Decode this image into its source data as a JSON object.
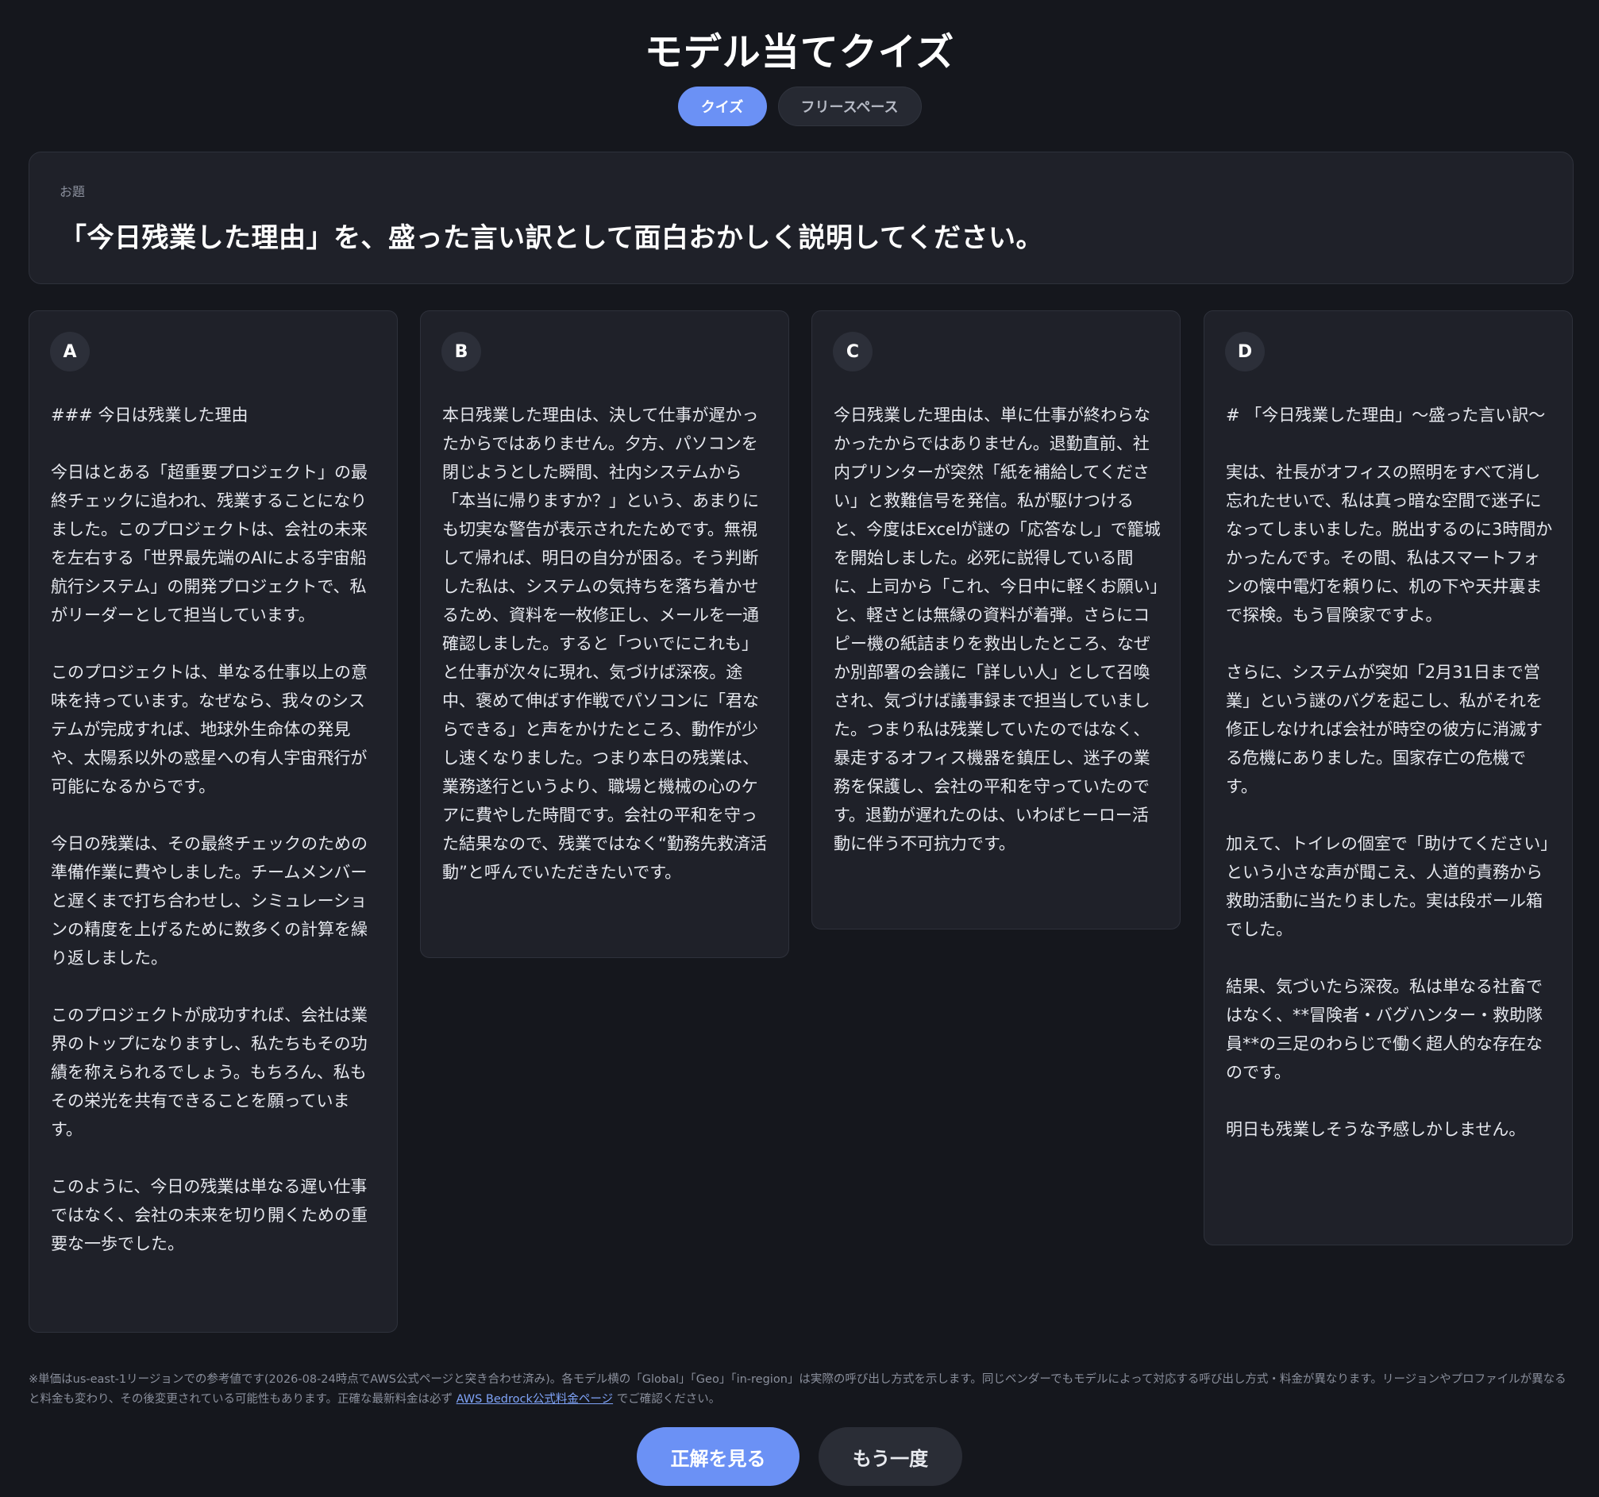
{
  "header": {
    "title": "モデル当てクイズ"
  },
  "tabs": [
    {
      "label": "クイズ",
      "active": true
    },
    {
      "label": "フリースペース",
      "active": false
    }
  ],
  "prompt": {
    "label": "お題",
    "text": "「今日残業した理由」を、盛った言い訳として面白おかしく説明してください。"
  },
  "answers": [
    {
      "letter": "A",
      "paragraphs": [
        "### 今日は残業した理由",
        "今日はとある「超重要プロジェクト」の最終チェックに追われ、残業することになりました。このプロジェクトは、会社の未来を左右する「世界最先端のAIによる宇宙船航行システム」の開発プロジェクトで、私がリーダーとして担当しています。",
        "このプロジェクトは、単なる仕事以上の意味を持っています。なぜなら、我々のシステムが完成すれば、地球外生命体の発見や、太陽系以外の惑星への有人宇宙飛行が可能になるからです。",
        "今日の残業は、その最終チェックのための準備作業に費やしました。チームメンバーと遅くまで打ち合わせし、シミュレーションの精度を上げるために数多くの計算を繰り返しました。",
        "このプロジェクトが成功すれば、会社は業界のトップになりますし、私たちもその功績を称えられるでしょう。もちろん、私もその栄光を共有できることを願っています。",
        "このように、今日の残業は単なる遅い仕事ではなく、会社の未来を切り開くための重要な一歩でした。"
      ]
    },
    {
      "letter": "B",
      "paragraphs": [
        "本日残業した理由は、決して仕事が遅かったからではありません。夕方、パソコンを閉じようとした瞬間、社内システムから「本当に帰りますか？」という、あまりにも切実な警告が表示されたためです。無視して帰れば、明日の自分が困る。そう判断した私は、システムの気持ちを落ち着かせるため、資料を一枚修正し、メールを一通確認しました。すると「ついでにこれも」と仕事が次々に現れ、気づけば深夜。途中、褒めて伸ばす作戦でパソコンに「君ならできる」と声をかけたところ、動作が少し速くなりました。つまり本日の残業は、業務遂行というより、職場と機械の心のケアに費やした時間です。会社の平和を守った結果なので、残業ではなく“勤務先救済活動”と呼んでいただきたいです。"
      ]
    },
    {
      "letter": "C",
      "paragraphs": [
        "今日残業した理由は、単に仕事が終わらなかったからではありません。退勤直前、社内プリンターが突然「紙を補給してください」と救難信号を発信。私が駆けつけると、今度はExcelが謎の「応答なし」で籠城を開始しました。必死に説得している間に、上司から「これ、今日中に軽くお願い」と、軽さとは無縁の資料が着弾。さらにコピー機の紙詰まりを救出したところ、なぜか別部署の会議に「詳しい人」として召喚され、気づけば議事録まで担当していました。つまり私は残業していたのではなく、暴走するオフィス機器を鎮圧し、迷子の業務を保護し、会社の平和を守っていたのです。退勤が遅れたのは、いわばヒーロー活動に伴う不可抗力です。"
      ]
    },
    {
      "letter": "D",
      "paragraphs": [
        "# 「今日残業した理由」〜盛った言い訳〜",
        "実は、社長がオフィスの照明をすべて消し忘れたせいで、私は真っ暗な空間で迷子になってしまいました。脱出するのに3時間かかったんです。その間、私はスマートフォンの懐中電灯を頼りに、机の下や天井裏まで探検。もう冒険家ですよ。",
        "さらに、システムが突如「2月31日まで営業」という謎のバグを起こし、私がそれを修正しなければ会社が時空の彼方に消滅する危機にありました。国家存亡の危機です。",
        "加えて、トイレの個室で「助けてください」という小さな声が聞こえ、人道的責務から救助活動に当たりました。実は段ボール箱でした。",
        "結果、気づいたら深夜。私は単なる社畜ではなく、**冒険者・バグハンター・救助隊員**の三足のわらじで働く超人的な存在なのです。",
        "明日も残業しそうな予感しかしません。"
      ]
    }
  ],
  "footnote": {
    "text": "※単価はus-east-1リージョンでの参考値です(2026-08-24時点でAWS公式ページと突き合わせ済み)。各モデル横の「Global」「Geo」「in-region」は実際の呼び出し方式を示します。同じベンダーでもモデルによって対応する呼び出し方式・料金が異なります。リージョンやプロファイルが異なると料金も変わり、その後変更されている可能性もあります。正確な最新料金は必ず ",
    "link_label": "AWS Bedrock公式料金ページ",
    "suffix": " でご確認ください。"
  },
  "actions": {
    "reveal_label": "正解を見る",
    "retry_label": "もう一度"
  },
  "colors": {
    "background": "#15171d",
    "card": "#1f2129",
    "accent": "#6b91f5"
  }
}
